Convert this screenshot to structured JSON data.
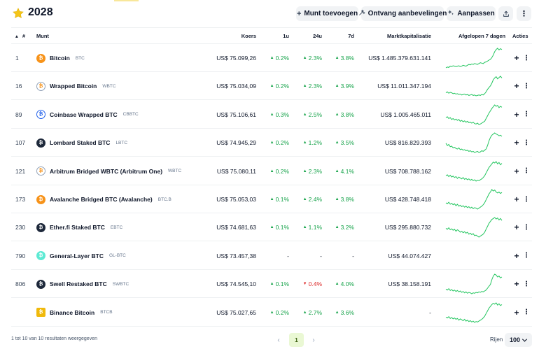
{
  "header": {
    "title": "2028",
    "buttons": {
      "add_coin": "Munt toevoegen",
      "recommendations": "Ontvang aanbevelingen",
      "customize": "Aanpassen"
    }
  },
  "table": {
    "columns": {
      "rank": "#",
      "coin": "Munt",
      "price": "Koers",
      "c1h": "1u",
      "c24h": "24u",
      "c7d": "7d",
      "market_cap": "Marktkapitalisatie",
      "spark": "Afgelopen 7 dagen",
      "actions": "Acties"
    },
    "rows": [
      {
        "rank": "1",
        "name": "Bitcoin",
        "symbol": "BTC",
        "logo_color": "#f7931a",
        "price": "US$ 75.099,26",
        "c1h": "0.2%",
        "c1h_dir": "up",
        "c24h": "2.3%",
        "c24h_dir": "up",
        "c7d": "3.8%",
        "c7d_dir": "up",
        "market_cap": "US$ 1.485.379.631.141",
        "spark": [
          12,
          14,
          13,
          16,
          15,
          17,
          16,
          15,
          16,
          17,
          15,
          16,
          18,
          17,
          16,
          18,
          20,
          19,
          21,
          20,
          22,
          21,
          20,
          22,
          24,
          23,
          22,
          25,
          26,
          28,
          30,
          32,
          36,
          42,
          50,
          55,
          58,
          54,
          57,
          55
        ]
      },
      {
        "rank": "16",
        "name": "Wrapped Bitcoin",
        "symbol": "WBTC",
        "logo_color": "#ffffff",
        "price": "US$ 75.034,09",
        "c1h": "0.2%",
        "c1h_dir": "up",
        "c24h": "2.3%",
        "c24h_dir": "up",
        "c7d": "3.9%",
        "c7d_dir": "up",
        "market_cap": "US$ 11.011.347.194",
        "spark": [
          18,
          20,
          17,
          19,
          18,
          16,
          17,
          15,
          16,
          14,
          15,
          13,
          14,
          15,
          13,
          14,
          12,
          13,
          14,
          12,
          13,
          11,
          12,
          13,
          12,
          14,
          13,
          16,
          20,
          26,
          30,
          34,
          40,
          48,
          52,
          55,
          50,
          53,
          56,
          52
        ]
      },
      {
        "rank": "89",
        "name": "Coinbase Wrapped BTC",
        "symbol": "CBBTC",
        "logo_color": "#ffffff",
        "price": "US$ 75.106,61",
        "c1h": "0.3%",
        "c1h_dir": "up",
        "c24h": "2.5%",
        "c24h_dir": "up",
        "c7d": "3.8%",
        "c7d_dir": "up",
        "market_cap": "US$ 1.005.465.011",
        "spark": [
          30,
          32,
          28,
          30,
          26,
          28,
          25,
          27,
          24,
          26,
          22,
          24,
          21,
          23,
          20,
          22,
          19,
          20,
          18,
          20,
          17,
          16,
          18,
          15,
          16,
          18,
          20,
          22,
          28,
          34,
          40,
          45,
          50,
          54,
          58,
          55,
          57,
          52,
          55,
          53
        ]
      },
      {
        "rank": "107",
        "name": "Lombard Staked BTC",
        "symbol": "LBTC",
        "logo_color": "#1e293b",
        "price": "US$ 74.945,29",
        "c1h": "0.2%",
        "c1h_dir": "up",
        "c24h": "1.2%",
        "c24h_dir": "up",
        "c7d": "3.5%",
        "c7d_dir": "up",
        "market_cap": "US$ 816.829.393",
        "spark": [
          34,
          30,
          32,
          28,
          29,
          26,
          27,
          25,
          24,
          26,
          23,
          24,
          22,
          23,
          21,
          22,
          20,
          21,
          19,
          20,
          18,
          19,
          20,
          18,
          19,
          21,
          20,
          22,
          24,
          30,
          38,
          44,
          48,
          50,
          52,
          50,
          49,
          47,
          48,
          46
        ]
      },
      {
        "rank": "121",
        "name": "Arbitrum Bridged WBTC (Arbitrum One)",
        "symbol": "WBTC",
        "logo_color": "#ffffff",
        "price": "US$ 75.080,11",
        "c1h": "0.2%",
        "c1h_dir": "up",
        "c24h": "2.3%",
        "c24h_dir": "up",
        "c7d": "4.1%",
        "c7d_dir": "up",
        "market_cap": "US$ 708.788.162",
        "spark": [
          26,
          28,
          24,
          27,
          23,
          25,
          22,
          24,
          20,
          23,
          21,
          19,
          22,
          18,
          20,
          17,
          19,
          16,
          18,
          15,
          17,
          14,
          16,
          15,
          17,
          19,
          22,
          26,
          32,
          38,
          44,
          48,
          52,
          56,
          54,
          57,
          52,
          55,
          50,
          53
        ]
      },
      {
        "rank": "173",
        "name": "Avalanche Bridged BTC (Avalanche)",
        "symbol": "BTC.B",
        "logo_color": "#f7931a",
        "price": "US$ 75.053,03",
        "c1h": "0.1%",
        "c1h_dir": "up",
        "c24h": "2.4%",
        "c24h_dir": "up",
        "c7d": "3.8%",
        "c7d_dir": "up",
        "market_cap": "US$ 428.748.418",
        "spark": [
          28,
          26,
          29,
          25,
          27,
          24,
          26,
          22,
          25,
          21,
          23,
          20,
          22,
          19,
          21,
          18,
          20,
          17,
          19,
          16,
          18,
          17,
          15,
          17,
          19,
          21,
          24,
          28,
          34,
          40,
          46,
          50,
          55,
          52,
          54,
          50,
          48,
          50,
          47,
          49
        ]
      },
      {
        "rank": "230",
        "name": "Ether.fi Staked BTC",
        "symbol": "EBTC",
        "logo_color": "#1e293b",
        "price": "US$ 74.681,63",
        "c1h": "0.1%",
        "c1h_dir": "up",
        "c24h": "1.1%",
        "c24h_dir": "up",
        "c7d": "3.2%",
        "c7d_dir": "up",
        "market_cap": "US$ 295.880.732",
        "spark": [
          30,
          28,
          31,
          27,
          29,
          26,
          28,
          24,
          27,
          25,
          22,
          24,
          21,
          23,
          20,
          22,
          18,
          20,
          17,
          19,
          15,
          16,
          14,
          12,
          14,
          16,
          18,
          22,
          28,
          34,
          40,
          44,
          48,
          50,
          52,
          49,
          51,
          47,
          50,
          46
        ]
      },
      {
        "rank": "790",
        "name": "General-Layer BTC",
        "symbol": "GL-BTC",
        "logo_color": "#5eead4",
        "price": "US$ 73.457,38",
        "c1h": "-",
        "c1h_dir": "none",
        "c24h": "-",
        "c24h_dir": "none",
        "c7d": "-",
        "c7d_dir": "none",
        "market_cap": "US$ 44.074.427",
        "spark": []
      },
      {
        "rank": "806",
        "name": "Swell Restaked BTC",
        "symbol": "SWBTC",
        "logo_color": "#1e293b",
        "price": "US$ 74.545,10",
        "c1h": "0.1%",
        "c1h_dir": "up",
        "c24h": "0.4%",
        "c24h_dir": "down",
        "c7d": "4.0%",
        "c7d_dir": "up",
        "market_cap": "US$ 38.158.191",
        "spark": [
          20,
          18,
          21,
          17,
          19,
          16,
          18,
          15,
          17,
          14,
          16,
          13,
          15,
          12,
          14,
          11,
          13,
          12,
          10,
          12,
          11,
          13,
          12,
          14,
          13,
          15,
          14,
          16,
          18,
          22,
          26,
          30,
          40,
          48,
          52,
          50,
          46,
          48,
          44,
          46
        ]
      },
      {
        "rank": "",
        "name": "Binance Bitcoin",
        "symbol": "BTCB",
        "logo_color": "#f0b90b",
        "price": "US$ 75.027,65",
        "c1h": "0.2%",
        "c1h_dir": "up",
        "c24h": "2.7%",
        "c24h_dir": "up",
        "c7d": "3.6%",
        "c7d_dir": "up",
        "market_cap": "-",
        "spark": [
          24,
          22,
          25,
          21,
          23,
          20,
          22,
          19,
          21,
          17,
          20,
          18,
          16,
          19,
          15,
          17,
          14,
          16,
          13,
          15,
          12,
          14,
          13,
          15,
          17,
          19,
          22,
          26,
          32,
          38,
          44,
          48,
          52,
          55,
          53,
          56,
          51,
          54,
          50,
          52
        ]
      }
    ]
  },
  "footer": {
    "info": "1 tot 10 van 10 resultaten weergegeven",
    "current_page": "1",
    "rows_label": "Rijen",
    "rows_value": "100"
  },
  "colors": {
    "up": "#16a34a",
    "down": "#dc2626",
    "spark": "#22c55e",
    "star": "#f5c518",
    "pager_active_bg": "#eaf8d4"
  }
}
